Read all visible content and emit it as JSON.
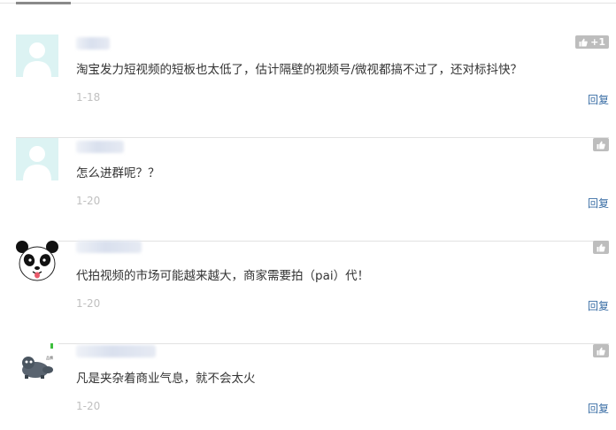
{
  "comments": [
    {
      "text": "淘宝发力短视频的短板也太低了，估计隔壁的视频号/微视都搞不过了，还对标抖快？",
      "date": "1-18",
      "likes": "+1",
      "reply_label": "回复",
      "avatar": "default-user-icon"
    },
    {
      "text": "怎么进群呢？？",
      "date": "1-20",
      "likes": "",
      "reply_label": "回复",
      "avatar": "default-user-icon"
    },
    {
      "text": "代拍视频的市场可能越来越大，商家需要拍（pai）代！",
      "date": "1-20",
      "likes": "",
      "reply_label": "回复",
      "avatar": "panda-avatar"
    },
    {
      "text": "凡是夹杂着商业气息，就不会太火",
      "date": "1-20",
      "likes": "",
      "reply_label": "回复",
      "avatar": "toy-avatar"
    }
  ],
  "colors": {
    "reply_link": "#3a6ea5",
    "like_badge": "#bdbdbd",
    "date_text": "#c0c0c0",
    "default_avatar_bg": "#dcf3f3"
  }
}
